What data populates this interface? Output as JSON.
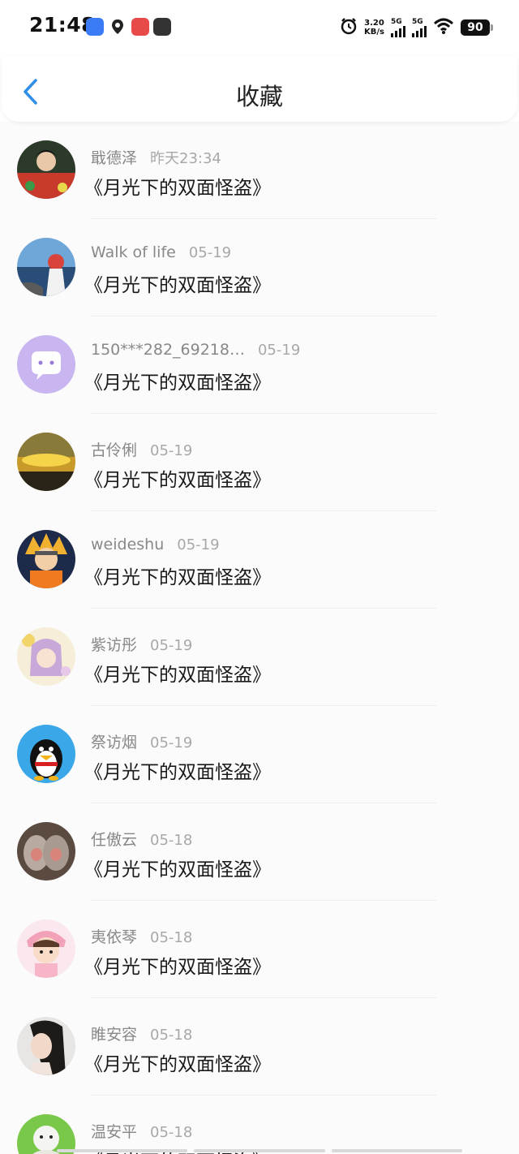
{
  "status_bar": {
    "time": "21:48",
    "net_speed_value": "3.20",
    "net_speed_unit": "KB/s",
    "signal1": "5G",
    "signal2": "5G",
    "battery": "90"
  },
  "header": {
    "title": "收藏",
    "back_icon": "chevron-left-icon"
  },
  "items": [
    {
      "username": "戢德泽",
      "date": "昨天23:34",
      "title": "《月光下的双面怪盗》"
    },
    {
      "username": "Walk of life",
      "date": "05-19",
      "title": "《月光下的双面怪盗》"
    },
    {
      "username": "150***282_69218…",
      "date": "05-19",
      "title": "《月光下的双面怪盗》"
    },
    {
      "username": "古伶俐",
      "date": "05-19",
      "title": "《月光下的双面怪盗》"
    },
    {
      "username": "weideshu",
      "date": "05-19",
      "title": "《月光下的双面怪盗》"
    },
    {
      "username": "紫访彤",
      "date": "05-19",
      "title": "《月光下的双面怪盗》"
    },
    {
      "username": "祭访烟",
      "date": "05-19",
      "title": "《月光下的双面怪盗》"
    },
    {
      "username": "任傲云",
      "date": "05-18",
      "title": "《月光下的双面怪盗》"
    },
    {
      "username": "夷依琴",
      "date": "05-18",
      "title": "《月光下的双面怪盗》"
    },
    {
      "username": "睢安容",
      "date": "05-18",
      "title": "《月光下的双面怪盗》"
    },
    {
      "username": "温安平",
      "date": "05-18",
      "title": "《月光下的双面怪盗》"
    }
  ],
  "colors": {
    "accent": "#2f8fe8",
    "username": "#888888",
    "date": "#a8a8a8",
    "title": "#1a1a1a"
  }
}
